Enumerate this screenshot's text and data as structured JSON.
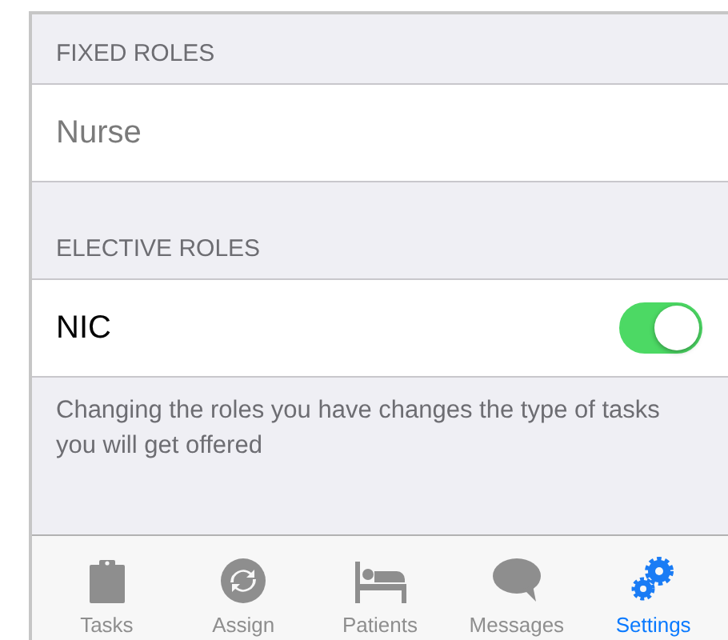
{
  "sections": [
    {
      "header": "FIXED ROLES",
      "rows": [
        {
          "kind": "static",
          "label": "Nurse"
        }
      ]
    },
    {
      "header": "ELECTIVE ROLES",
      "rows": [
        {
          "kind": "toggle",
          "label": "NIC",
          "on": true
        }
      ],
      "footer": "Changing the roles you have changes the type of tasks you will get offered"
    }
  ],
  "tabs": [
    {
      "kind": "clipboard",
      "label": "Tasks",
      "selected": false
    },
    {
      "kind": "cycle",
      "label": "Assign",
      "selected": false
    },
    {
      "kind": "bed",
      "label": "Patients",
      "selected": false
    },
    {
      "kind": "bubble",
      "label": "Messages",
      "selected": false
    },
    {
      "kind": "gears",
      "label": "Settings",
      "selected": true
    }
  ]
}
